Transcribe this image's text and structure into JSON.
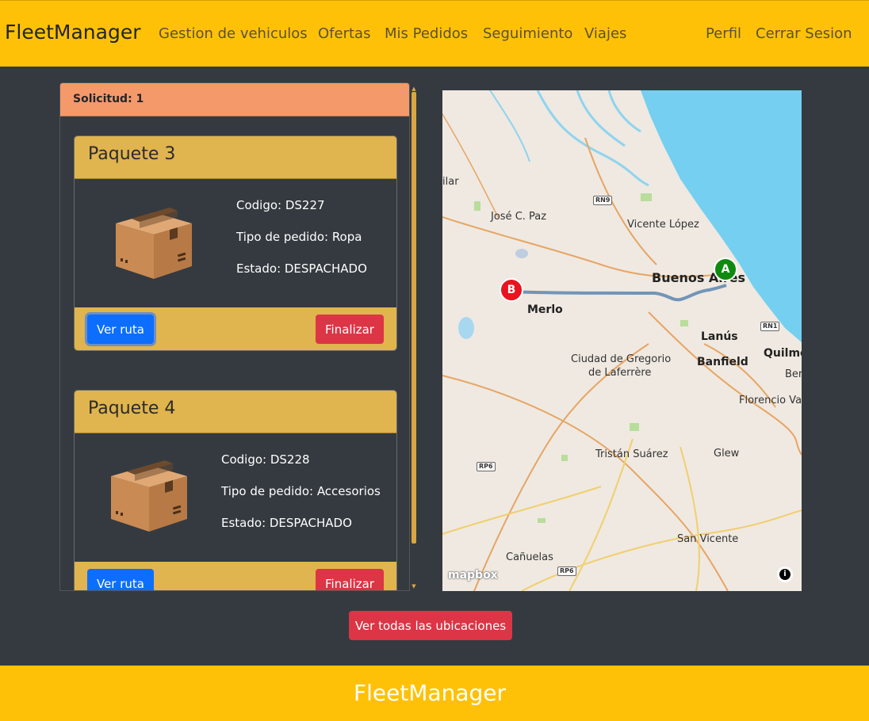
{
  "navbar": {
    "brand": "FleetManager",
    "links": [
      "Gestion de vehiculos",
      "Ofertas",
      "Mis Pedidos",
      "Seguimiento",
      "Viajes"
    ],
    "right_links": [
      "Perfil",
      "Cerrar Sesion"
    ]
  },
  "request": {
    "header": "Solicitud: 1",
    "packages": [
      {
        "title": "Paquete 3",
        "codigo": "Codigo: DS227",
        "tipo": "Tipo de pedido: Ropa",
        "estado": "Estado: DESPACHADO",
        "route_label": "Ver ruta",
        "finish_label": "Finalizar"
      },
      {
        "title": "Paquete 4",
        "codigo": "Codigo: DS228",
        "tipo": "Tipo de pedido: Accesorios",
        "estado": "Estado: DESPACHADO",
        "route_label": "Ver ruta",
        "finish_label": "Finalizar"
      }
    ]
  },
  "map": {
    "labels": {
      "pilar": "ilar",
      "jose_c_paz": "José C. Paz",
      "vicente_lopez": "Vicente López",
      "buenos_aires": "Buenos Aires",
      "merlo": "Merlo",
      "lanus": "Lanús",
      "quilmes": "Quilme",
      "banfield": "Banfield",
      "berazategui": "Ber",
      "gregorio_1": "Ciudad de Gregorio",
      "gregorio_2": "de Laferrère",
      "florencio_varela": "Florencio Va",
      "tristan_suarez": "Tristán Suárez",
      "glew": "Glew",
      "san_vicente": "San Vicente",
      "canuelas": "Cañuelas"
    },
    "roads": {
      "rn9": "RN9",
      "rn1": "RN1",
      "rp6_a": "RP6",
      "rp6_b": "RP6"
    },
    "markers": {
      "origin": "A",
      "destination": "B"
    },
    "attribution": "mapbox",
    "info_icon": "i",
    "colors": {
      "water": "#75cff0",
      "route": "#5a86b0",
      "origin": "#0f8a0f",
      "destination": "#e8141f"
    }
  },
  "actions": {
    "all_locations": "Ver todas las ubicaciones"
  },
  "footer": {
    "brand": "FleetManager"
  },
  "colors": {
    "navbar": "#ffc107",
    "background": "#343a40",
    "card_header": "#e0b44e",
    "panel_header": "#f4996a",
    "primary": "#0d6efd",
    "danger": "#dc3545"
  }
}
